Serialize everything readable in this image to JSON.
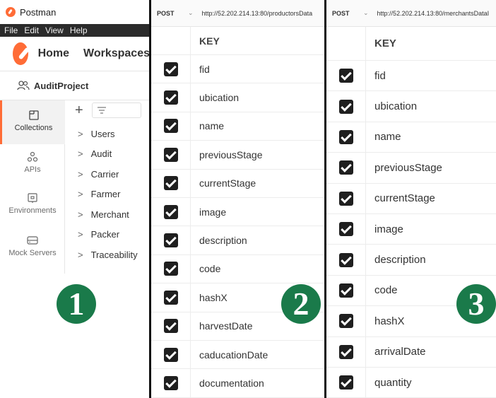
{
  "panel1": {
    "app_title": "Postman",
    "menu": [
      "File",
      "Edit",
      "View",
      "Help"
    ],
    "nav": {
      "home": "Home",
      "workspaces": "Workspaces"
    },
    "workspace_name": "AuditProject",
    "tabs": [
      {
        "label": "Collections",
        "icon": "collections-icon",
        "active": true
      },
      {
        "label": "APIs",
        "icon": "apis-icon",
        "active": false
      },
      {
        "label": "Environments",
        "icon": "environments-icon",
        "active": false
      },
      {
        "label": "Mock Servers",
        "icon": "mock-servers-icon",
        "active": false
      }
    ],
    "collections": [
      "Users",
      "Audit",
      "Carrier",
      "Farmer",
      "Merchant",
      "Packer",
      "Traceability"
    ],
    "badge": "1"
  },
  "panel2": {
    "method": "POST",
    "url": "http://52.202.214.13:80/productorsData",
    "key_header": "KEY",
    "keys": [
      "fid",
      "ubication",
      "name",
      "previousStage",
      "currentStage",
      "image",
      "description",
      "code",
      "hashX",
      "harvestDate",
      "caducationDate",
      "documentation"
    ],
    "badge": "2"
  },
  "panel3": {
    "method": "POST",
    "url": "http://52.202.214.13:80/merchantsDataI",
    "key_header": "KEY",
    "keys": [
      "fid",
      "ubication",
      "name",
      "previousStage",
      "currentStage",
      "image",
      "description",
      "code",
      "hashX",
      "arrivalDate",
      "quantity"
    ],
    "badge": "3"
  },
  "colors": {
    "accent": "#ff6c37",
    "badge_green": "#1a7a4a",
    "menubar": "#2b2b2b",
    "checkbox": "#1f1f1f"
  }
}
